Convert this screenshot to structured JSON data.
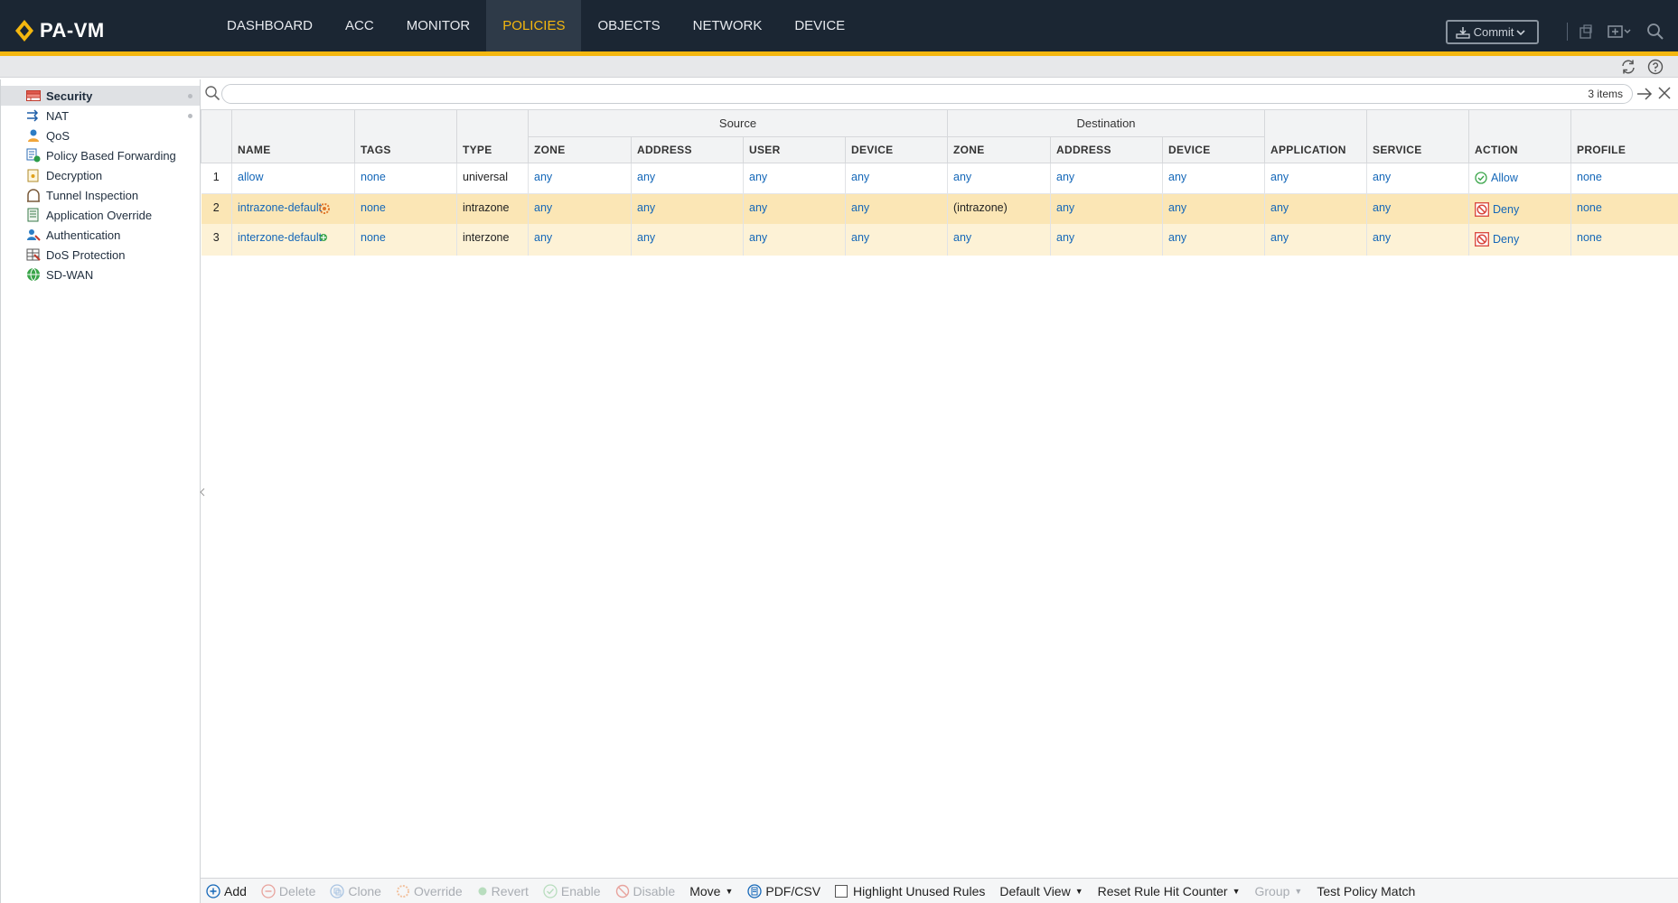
{
  "app": {
    "name": "PA-VM",
    "colors": {
      "header_bg": "#1b2633",
      "accent": "#f4b70f",
      "link": "#1467b8",
      "deny": "#d9453b",
      "allow": "#3aa54a"
    }
  },
  "nav": {
    "tabs": [
      "DASHBOARD",
      "ACC",
      "MONITOR",
      "POLICIES",
      "OBJECTS",
      "NETWORK",
      "DEVICE"
    ],
    "active": "POLICIES"
  },
  "header": {
    "commit_label": "Commit"
  },
  "sidebar": {
    "items": [
      {
        "label": "Security",
        "icon": "security-icon",
        "active": true
      },
      {
        "label": "NAT",
        "icon": "nat-icon"
      },
      {
        "label": "QoS",
        "icon": "qos-icon"
      },
      {
        "label": "Policy Based Forwarding",
        "icon": "pbf-icon"
      },
      {
        "label": "Decryption",
        "icon": "decryption-icon"
      },
      {
        "label": "Tunnel Inspection",
        "icon": "tunnel-inspection-icon"
      },
      {
        "label": "Application Override",
        "icon": "application-override-icon"
      },
      {
        "label": "Authentication",
        "icon": "authentication-icon"
      },
      {
        "label": "DoS Protection",
        "icon": "dos-protection-icon"
      },
      {
        "label": "SD-WAN",
        "icon": "sdwan-icon"
      }
    ]
  },
  "search": {
    "value": "",
    "count": "3 items"
  },
  "table": {
    "groups": {
      "source": "Source",
      "destination": "Destination"
    },
    "columns": {
      "name": "NAME",
      "tags": "TAGS",
      "type": "TYPE",
      "src_zone": "ZONE",
      "src_address": "ADDRESS",
      "src_user": "USER",
      "src_device": "DEVICE",
      "dst_zone": "ZONE",
      "dst_address": "ADDRESS",
      "dst_device": "DEVICE",
      "application": "APPLICATION",
      "service": "SERVICE",
      "action": "ACTION",
      "profile": "PROFILE"
    },
    "rows": [
      {
        "num": "1",
        "name": "allow",
        "tags": "none",
        "type": "universal",
        "src_zone": "any",
        "src_address": "any",
        "src_user": "any",
        "src_device": "any",
        "dst_zone": "any",
        "dst_address": "any",
        "dst_device": "any",
        "application": "any",
        "service": "any",
        "action": "Allow",
        "profile": "none"
      },
      {
        "num": "2",
        "name": "intrazone-default",
        "tags": "none",
        "type": "intrazone",
        "src_zone": "any",
        "src_address": "any",
        "src_user": "any",
        "src_device": "any",
        "dst_zone": "(intrazone)",
        "dst_address": "any",
        "dst_device": "any",
        "application": "any",
        "service": "any",
        "action": "Deny",
        "profile": "none"
      },
      {
        "num": "3",
        "name": "interzone-default",
        "tags": "none",
        "type": "interzone",
        "src_zone": "any",
        "src_address": "any",
        "src_user": "any",
        "src_device": "any",
        "dst_zone": "any",
        "dst_address": "any",
        "dst_device": "any",
        "application": "any",
        "service": "any",
        "action": "Deny",
        "profile": "none"
      }
    ]
  },
  "toolbar": {
    "add": "Add",
    "delete": "Delete",
    "clone": "Clone",
    "override": "Override",
    "revert": "Revert",
    "enable": "Enable",
    "disable": "Disable",
    "move": "Move",
    "pdf_csv": "PDF/CSV",
    "highlight_unused": "Highlight Unused Rules",
    "default_view": "Default View",
    "reset_hit_counter": "Reset Rule Hit Counter",
    "group": "Group",
    "test_policy_match": "Test Policy Match"
  }
}
